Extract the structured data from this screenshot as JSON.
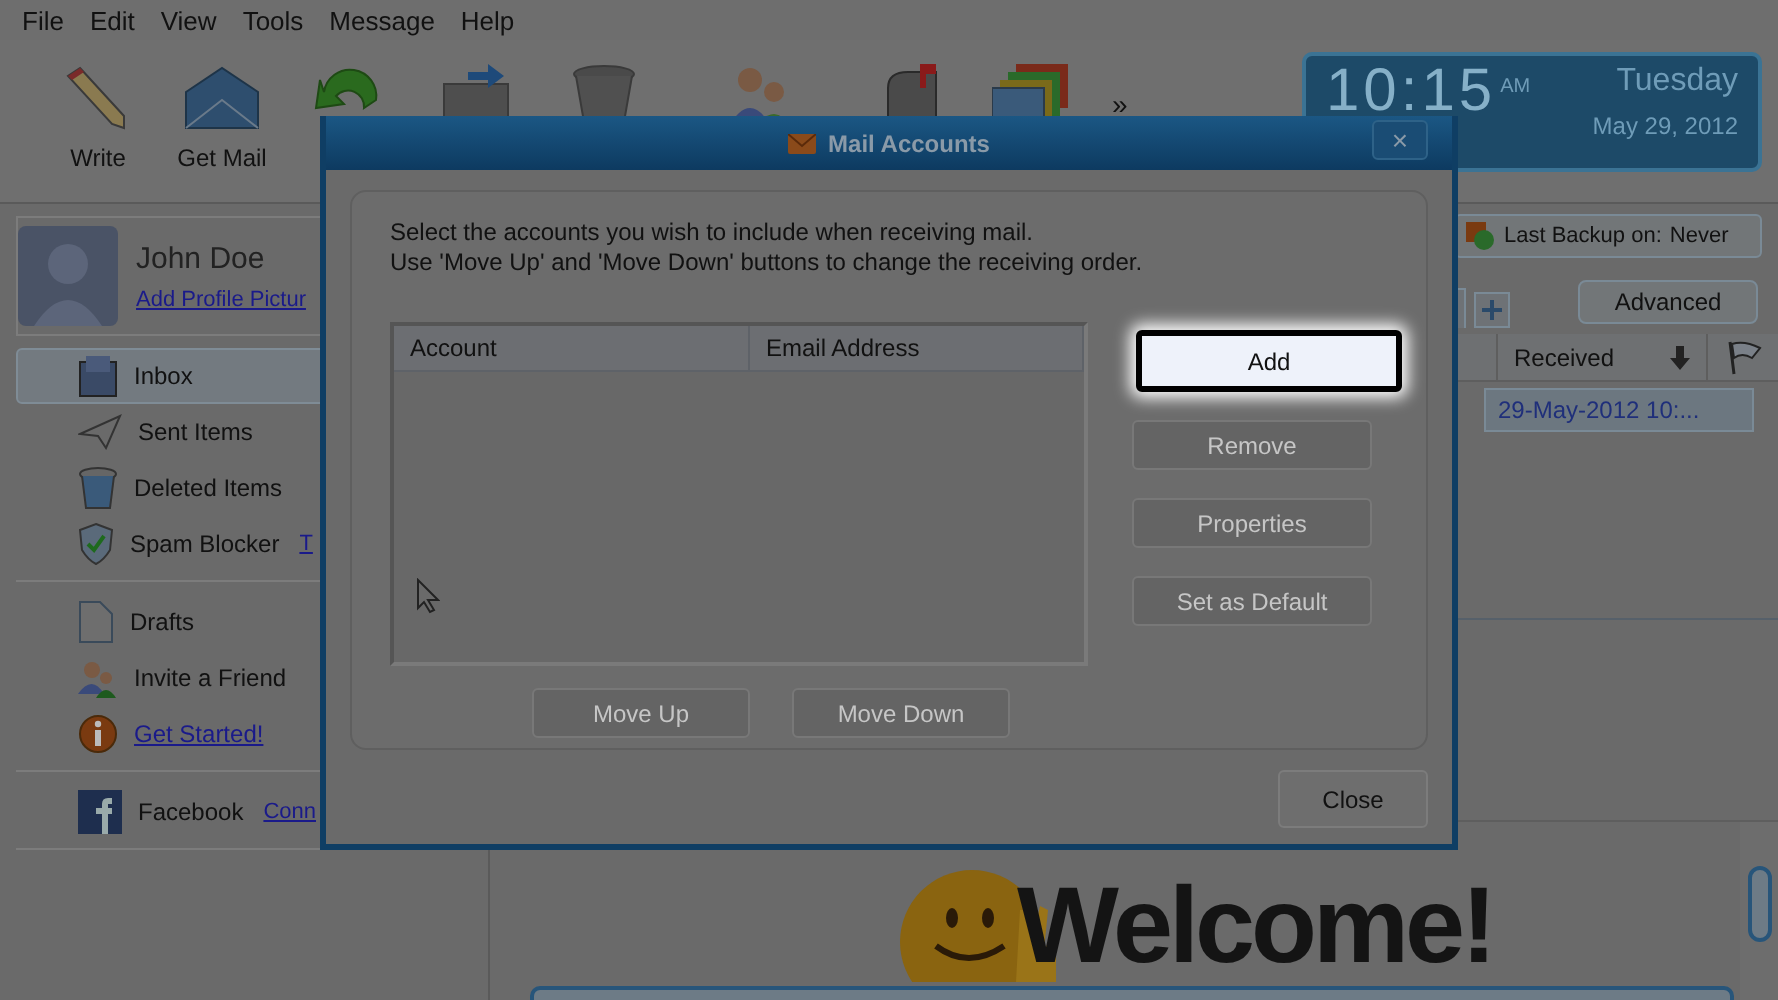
{
  "menu": [
    {
      "label": "File"
    },
    {
      "label": "Edit"
    },
    {
      "label": "View"
    },
    {
      "label": "Tools"
    },
    {
      "label": "Message"
    },
    {
      "label": "Help"
    }
  ],
  "toolbar": {
    "buttons": [
      {
        "kind": "write",
        "label": "Write"
      },
      {
        "kind": "get-mail",
        "label": "Get Mail"
      },
      {
        "kind": "reply"
      },
      {
        "kind": "forward"
      },
      {
        "kind": "trash"
      },
      {
        "kind": "contacts"
      },
      {
        "kind": "mailbox"
      },
      {
        "kind": "calendar"
      }
    ],
    "overflow": "»"
  },
  "clock": {
    "time": "10:15",
    "meridiem": "AM",
    "day": "Tuesday",
    "date": "May 29, 2012"
  },
  "profile": {
    "name": "John Doe",
    "link": "Add Profile Pictur"
  },
  "sidebar": {
    "groups": [
      {
        "items": [
          {
            "kind": "inbox",
            "label": "Inbox",
            "selected": true
          },
          {
            "kind": "sent",
            "label": "Sent Items",
            "selected": false
          },
          {
            "kind": "deleted",
            "label": "Deleted Items",
            "selected": false
          },
          {
            "kind": "spam",
            "label": "Spam Blocker",
            "selected": false,
            "extra": "T"
          }
        ]
      },
      {
        "items": [
          {
            "kind": "drafts",
            "label": "Drafts",
            "selected": false
          },
          {
            "kind": "invite",
            "label": "Invite a Friend",
            "selected": false
          },
          {
            "kind": "info",
            "label": "Get Started!",
            "selected": false,
            "link": true
          }
        ]
      },
      {
        "items": [
          {
            "kind": "facebook",
            "label": "Facebook",
            "selected": false,
            "extra": "Conn"
          }
        ]
      }
    ]
  },
  "backup": {
    "label": "Last Backup on:",
    "value": "Never"
  },
  "advanced": "Advanced",
  "message_list": {
    "column": "Received",
    "row": "29-May-2012 10:..."
  },
  "welcome": "Welcome!",
  "dialog": {
    "title": "Mail Accounts",
    "instructions": [
      "Select the accounts you wish to include when receiving mail.",
      "Use 'Move Up' and 'Move Down' buttons to change the receiving order."
    ],
    "columns": [
      "Account",
      "Email Address"
    ],
    "side_buttons": [
      {
        "label": "Add",
        "disabled": false,
        "highlighted": true
      },
      {
        "label": "Remove",
        "disabled": true,
        "highlighted": false
      },
      {
        "label": "Properties",
        "disabled": true,
        "highlighted": false
      },
      {
        "label": "Set as Default",
        "disabled": true,
        "highlighted": false
      }
    ],
    "order_buttons": [
      {
        "label": "Move Up",
        "disabled": true
      },
      {
        "label": "Move Down",
        "disabled": true
      }
    ],
    "close": "Close",
    "close_glyph": "×"
  }
}
